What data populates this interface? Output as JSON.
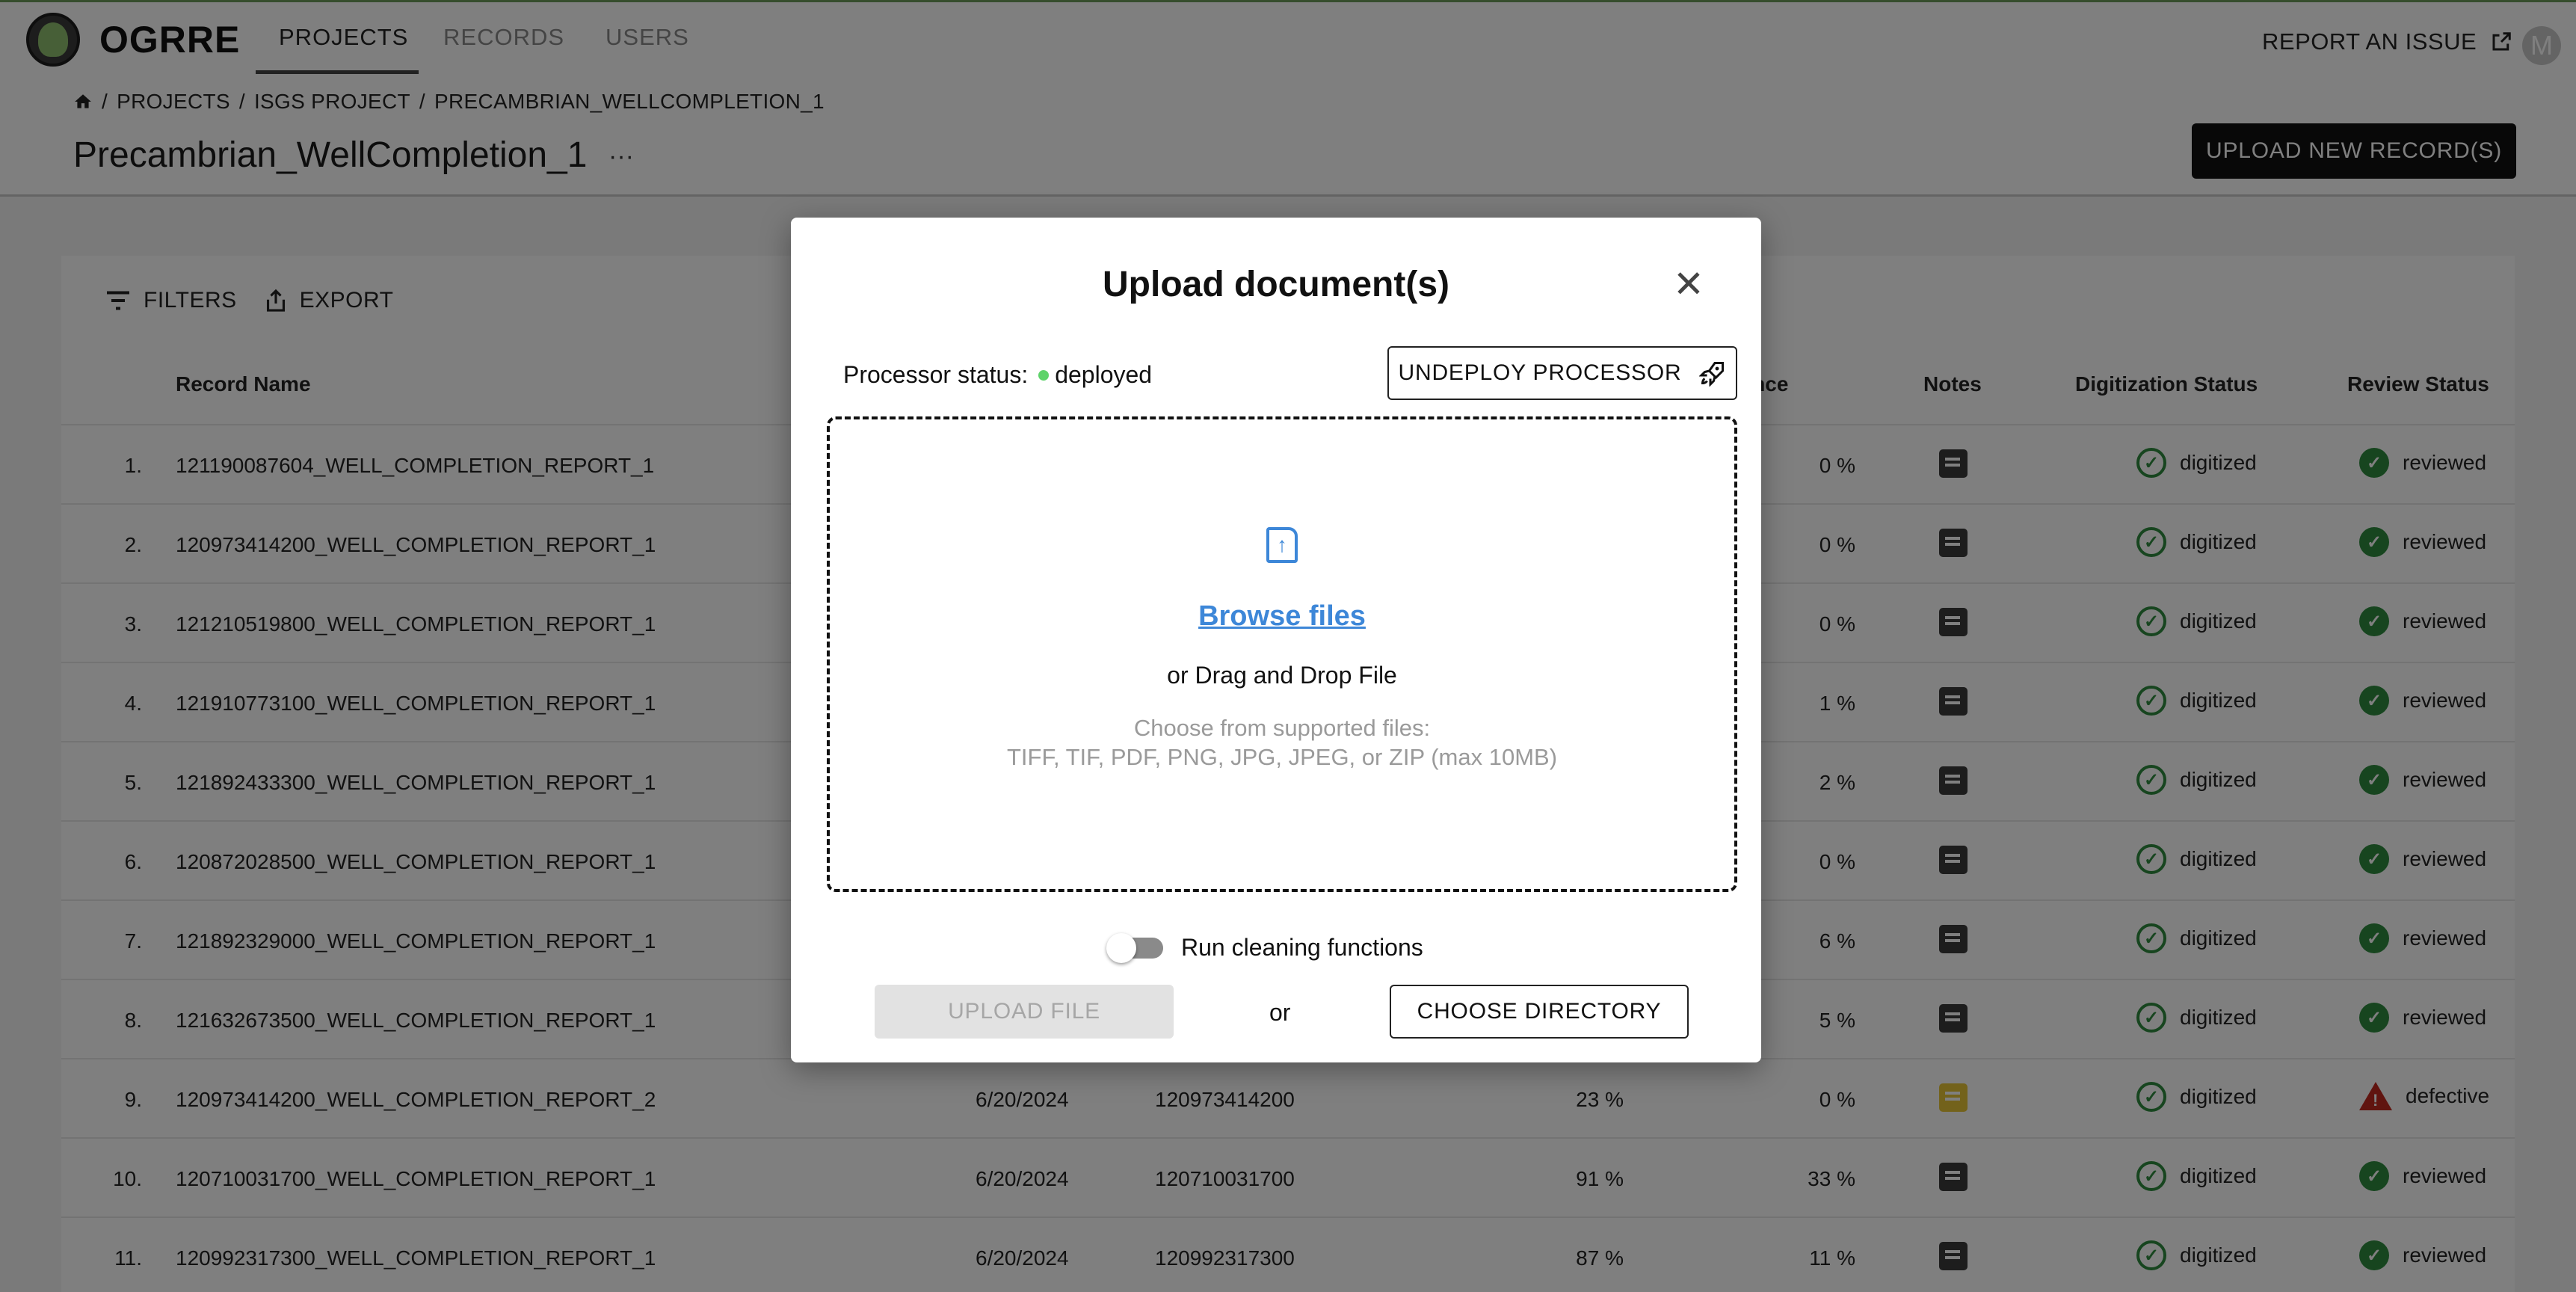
{
  "app": {
    "brand": "OGRRE",
    "report_issue": "REPORT AN ISSUE",
    "avatar_initial": "M"
  },
  "nav": {
    "tabs": [
      "PROJECTS",
      "RECORDS",
      "USERS"
    ]
  },
  "breadcrumb": [
    "PROJECTS",
    "ISGS PROJECT",
    "PRECAMBRIAN_WELLCOMPLETION_1"
  ],
  "page": {
    "title": "Precambrian_WellCompletion_1",
    "more": "···",
    "upload_new": "UPLOAD NEW RECORD(S)"
  },
  "toolbar": {
    "filters": "FILTERS",
    "export": "EXPORT"
  },
  "table": {
    "headers": {
      "name": "Record Name",
      "confidence": "Confidence",
      "notes": "Notes",
      "digitization": "Digitization Status",
      "review": "Review Status"
    },
    "rows": [
      {
        "num": "1.",
        "name": "121190087604_WELL_COMPLETION_REPORT_1",
        "date": "",
        "api": "",
        "pct": "",
        "conf": "0 %",
        "note": "default",
        "digitization": "digitized",
        "review": "reviewed",
        "review_state": "ok"
      },
      {
        "num": "2.",
        "name": "120973414200_WELL_COMPLETION_REPORT_1",
        "date": "",
        "api": "",
        "pct": "",
        "conf": "0 %",
        "note": "default",
        "digitization": "digitized",
        "review": "reviewed",
        "review_state": "ok"
      },
      {
        "num": "3.",
        "name": "121210519800_WELL_COMPLETION_REPORT_1",
        "date": "",
        "api": "",
        "pct": "",
        "conf": "0 %",
        "note": "default",
        "digitization": "digitized",
        "review": "reviewed",
        "review_state": "ok"
      },
      {
        "num": "4.",
        "name": "121910773100_WELL_COMPLETION_REPORT_1",
        "date": "",
        "api": "",
        "pct": "",
        "conf": "1 %",
        "note": "default",
        "digitization": "digitized",
        "review": "reviewed",
        "review_state": "ok"
      },
      {
        "num": "5.",
        "name": "121892433300_WELL_COMPLETION_REPORT_1",
        "date": "",
        "api": "",
        "pct": "",
        "conf": "2 %",
        "note": "default",
        "digitization": "digitized",
        "review": "reviewed",
        "review_state": "ok"
      },
      {
        "num": "6.",
        "name": "120872028500_WELL_COMPLETION_REPORT_1",
        "date": "",
        "api": "",
        "pct": "",
        "conf": "0 %",
        "note": "default",
        "digitization": "digitized",
        "review": "reviewed",
        "review_state": "ok"
      },
      {
        "num": "7.",
        "name": "121892329000_WELL_COMPLETION_REPORT_1",
        "date": "",
        "api": "",
        "pct": "",
        "conf": "6 %",
        "note": "default",
        "digitization": "digitized",
        "review": "reviewed",
        "review_state": "ok"
      },
      {
        "num": "8.",
        "name": "121632673500_WELL_COMPLETION_REPORT_1",
        "date": "",
        "api": "",
        "pct": "",
        "conf": "5 %",
        "note": "default",
        "digitization": "digitized",
        "review": "reviewed",
        "review_state": "ok"
      },
      {
        "num": "9.",
        "name": "120973414200_WELL_COMPLETION_REPORT_2",
        "date": "6/20/2024",
        "api": "120973414200",
        "pct": "23 %",
        "conf": "0 %",
        "note": "flagged",
        "digitization": "digitized",
        "review": "defective",
        "review_state": "warn"
      },
      {
        "num": "10.",
        "name": "120710031700_WELL_COMPLETION_REPORT_1",
        "date": "6/20/2024",
        "api": "120710031700",
        "pct": "91 %",
        "conf": "33 %",
        "note": "default",
        "digitization": "digitized",
        "review": "reviewed",
        "review_state": "ok"
      },
      {
        "num": "11.",
        "name": "120992317300_WELL_COMPLETION_REPORT_1",
        "date": "6/20/2024",
        "api": "120992317300",
        "pct": "87 %",
        "conf": "11 %",
        "note": "default",
        "digitization": "digitized",
        "review": "reviewed",
        "review_state": "ok"
      }
    ]
  },
  "modal": {
    "title": "Upload document(s)",
    "processor_label": "Processor status:",
    "processor_status": "deployed",
    "undeploy": "UNDEPLOY PROCESSOR",
    "browse": "Browse files",
    "drag": "or Drag and Drop File",
    "supported_heading": "Choose from supported files:",
    "supported_types": "TIFF, TIF, PDF, PNG, JPG, JPEG, or ZIP (max 10MB)",
    "toggle_label": "Run cleaning functions",
    "toggle_on": false,
    "upload_file": "UPLOAD FILE",
    "or": "or",
    "choose_directory": "CHOOSE DIRECTORY"
  },
  "colors": {
    "accent_blue": "#3d87d8",
    "status_green": "#2e8b3e",
    "deployed_dot": "#5ed36a",
    "defective_red": "#c0281e",
    "note_flag": "#e6c436"
  }
}
